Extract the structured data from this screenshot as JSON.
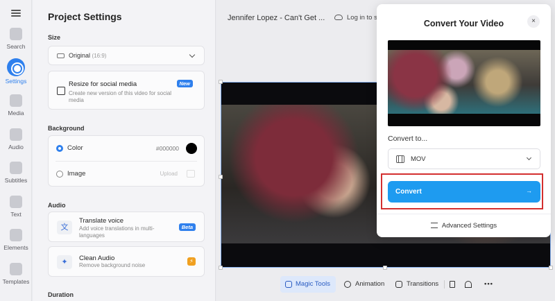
{
  "rail": {
    "items": [
      {
        "label": "Search",
        "icon": "search-icon"
      },
      {
        "label": "Settings",
        "icon": "settings-icon",
        "active": true
      },
      {
        "label": "Media",
        "icon": "plus-icon"
      },
      {
        "label": "Audio",
        "icon": "music-icon"
      },
      {
        "label": "Subtitles",
        "icon": "subtitles-icon"
      },
      {
        "label": "Text",
        "icon": "text-icon"
      },
      {
        "label": "Elements",
        "icon": "elements-icon"
      },
      {
        "label": "Templates",
        "icon": "templates-icon"
      }
    ]
  },
  "panel": {
    "title": "Project Settings",
    "size_heading": "Size",
    "size_select": {
      "value": "Original",
      "ratio": "(16:9)"
    },
    "resize": {
      "title": "Resize for social media",
      "desc": "Create new version of this video for social media",
      "badge": "New"
    },
    "background_heading": "Background",
    "background": {
      "color_label": "Color",
      "color_value": "#000000",
      "image_label": "Image",
      "upload_label": "Upload"
    },
    "audio_heading": "Audio",
    "translate": {
      "title": "Translate voice",
      "desc": "Add voice translations in multi-languages",
      "badge": "Beta"
    },
    "clean": {
      "title": "Clean Audio",
      "desc": "Remove background noise"
    },
    "duration_heading": "Duration"
  },
  "main": {
    "project_title": "Jennifer Lopez - Can't Get ...",
    "login_label": "Log in to sa"
  },
  "toolbar": {
    "magic": "Magic Tools",
    "animation": "Animation",
    "transitions": "Transitions",
    "more": "•••"
  },
  "dialog": {
    "title": "Convert Your Video",
    "close": "×",
    "convert_to_label": "Convert to...",
    "format_value": "MOV",
    "convert_button": "Convert",
    "advanced": "Advanced Settings"
  },
  "colors": {
    "accent": "#1e9bf0",
    "highlight": "#d32f2f",
    "badge": "#2f80ed"
  }
}
